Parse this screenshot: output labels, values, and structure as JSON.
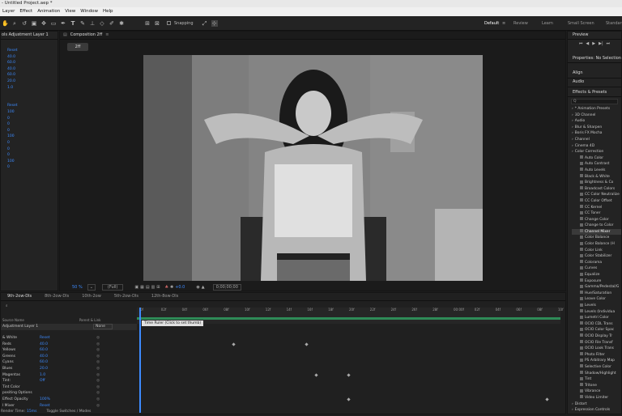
{
  "title": "- Untitled Project.aep *",
  "menu": [
    "Layer",
    "Effect",
    "Animation",
    "View",
    "Window",
    "Help"
  ],
  "toolbar": {
    "snapping": "Snapping"
  },
  "workspaces": [
    "Default",
    "Review",
    "Learn",
    "Small Screen",
    "Standard"
  ],
  "effect_controls": {
    "tab": "ols Adjustment Layer 1",
    "values": [
      "Reset",
      "40.0",
      "60.0",
      "40.0",
      "60.0",
      "20.0",
      "1.0",
      "",
      "",
      "Reset",
      "100",
      "0",
      "0",
      "0",
      "100",
      "0",
      "0",
      "0",
      "100",
      "0",
      ""
    ]
  },
  "composition": {
    "tab": "Composition 2ff",
    "sub_tab": "2ff",
    "zoom": "50 %",
    "quality": "(Full)",
    "exposure": "+0.0",
    "timecode": "0;00;00;00"
  },
  "preview": {
    "label": "Preview"
  },
  "properties": {
    "label": "Properties: No Selection"
  },
  "align": {
    "label": "Align"
  },
  "audio": {
    "label": "Audio"
  },
  "effects_presets": {
    "label": "Effects & Presets",
    "search_placeholder": "Q",
    "items": [
      {
        "text": "* Animation Presets",
        "indent": 0
      },
      {
        "text": "3D Channel",
        "indent": 0
      },
      {
        "text": "Audio",
        "indent": 0
      },
      {
        "text": "Blur & Sharpen",
        "indent": 0
      },
      {
        "text": "Boris FX Mocha",
        "indent": 0
      },
      {
        "text": "Channel",
        "indent": 0
      },
      {
        "text": "Cinema 4D",
        "indent": 0
      },
      {
        "text": "Color Correction",
        "indent": 0
      },
      {
        "text": "Auto Color",
        "indent": 1
      },
      {
        "text": "Auto Contrast",
        "indent": 1
      },
      {
        "text": "Auto Levels",
        "indent": 1
      },
      {
        "text": "Black & White",
        "indent": 1
      },
      {
        "text": "Brightness & Co",
        "indent": 1
      },
      {
        "text": "Broadcast Colors",
        "indent": 1
      },
      {
        "text": "CC Color Neutralize",
        "indent": 1
      },
      {
        "text": "CC Color Offset",
        "indent": 1
      },
      {
        "text": "CC Kernel",
        "indent": 1
      },
      {
        "text": "CC Toner",
        "indent": 1
      },
      {
        "text": "Change Color",
        "indent": 1
      },
      {
        "text": "Change to Color",
        "indent": 1
      },
      {
        "text": "Channel Mixer",
        "indent": 1,
        "selected": true
      },
      {
        "text": "Color Balance",
        "indent": 1
      },
      {
        "text": "Color Balance (H",
        "indent": 1
      },
      {
        "text": "Color Link",
        "indent": 1
      },
      {
        "text": "Color Stabilizer",
        "indent": 1
      },
      {
        "text": "Colorama",
        "indent": 1
      },
      {
        "text": "Curves",
        "indent": 1
      },
      {
        "text": "Equalize",
        "indent": 1
      },
      {
        "text": "Exposure",
        "indent": 1
      },
      {
        "text": "Gamma/Pedestal/G",
        "indent": 1
      },
      {
        "text": "Hue/Saturation",
        "indent": 1
      },
      {
        "text": "Leave Color",
        "indent": 1
      },
      {
        "text": "Levels",
        "indent": 1
      },
      {
        "text": "Levels (Individua",
        "indent": 1
      },
      {
        "text": "Lumetri Color",
        "indent": 1
      },
      {
        "text": "OCIO CDL Trans",
        "indent": 1
      },
      {
        "text": "OCIO Color Spac",
        "indent": 1
      },
      {
        "text": "OCIO Display Tr",
        "indent": 1
      },
      {
        "text": "OCIO File Transf",
        "indent": 1
      },
      {
        "text": "OCIO Look Trans",
        "indent": 1
      },
      {
        "text": "Photo Filter",
        "indent": 1
      },
      {
        "text": "PS Arbitrary Map",
        "indent": 1
      },
      {
        "text": "Selective Color",
        "indent": 1
      },
      {
        "text": "Shadow/Highlight",
        "indent": 1
      },
      {
        "text": "Tint",
        "indent": 1
      },
      {
        "text": "Tritone",
        "indent": 1
      },
      {
        "text": "Vibrance",
        "indent": 1
      },
      {
        "text": "Video Limiter",
        "indent": 1
      },
      {
        "text": "Distort",
        "indent": 0
      },
      {
        "text": "Expression Controls",
        "indent": 0
      }
    ]
  },
  "timeline_tabs": [
    "9th-2ow-Dls",
    "8th-2ow-Dls",
    "10th-2ow",
    "5th-2ow-Dls",
    "12th-8ow-Dls"
  ],
  "timeline": {
    "columns": {
      "source": "Source Name",
      "parent": "Parent & Link"
    },
    "layer_name": "Adjustment Layer 1",
    "parent_value": "None",
    "tooltip": "Time Ruler (Click to set thumb)",
    "ruler": [
      "0f",
      "02f",
      "04f",
      "06f",
      "08f",
      "10f",
      "12f",
      "14f",
      "16f",
      "18f",
      "20f",
      "22f",
      "24f",
      "26f",
      "28f",
      "00:00f",
      "02f",
      "04f",
      "06f",
      "08f",
      "10f"
    ],
    "properties": [
      {
        "name": "& White",
        "value": "Reset"
      },
      {
        "name": "Reds",
        "value": "40.0"
      },
      {
        "name": "Yellows",
        "value": "60.0"
      },
      {
        "name": "Greens",
        "value": "40.0"
      },
      {
        "name": "Cyans",
        "value": "60.0"
      },
      {
        "name": "Blues",
        "value": "20.0"
      },
      {
        "name": "Magentas",
        "value": "1.0"
      },
      {
        "name": "Tint:",
        "value": "Off"
      },
      {
        "name": "Tint Color",
        "value": ""
      },
      {
        "name": "positing Options",
        "value": ""
      },
      {
        "name": "Effect Opacity",
        "value": "100%"
      },
      {
        "name": "l Mixer",
        "value": "Reset"
      }
    ],
    "footer_render": "Render Time:",
    "footer_render_value": "15ms",
    "footer_toggle": "Toggle Switches / Modes"
  }
}
